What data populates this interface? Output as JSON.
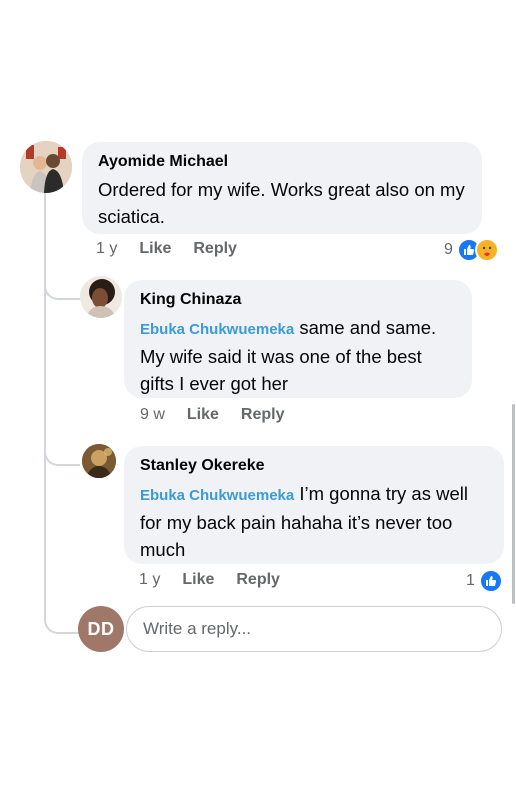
{
  "comments": [
    {
      "author": "Ayomide Michael",
      "text": "Ordered for my wife. Works great also on my sciatica.",
      "time": "1 y",
      "like_label": "Like",
      "reply_label": "Reply",
      "reaction_count": "9",
      "reactions": [
        "like-icon",
        "care-icon"
      ]
    },
    {
      "author": "King Chinaza",
      "mention": "Ebuka Chukwuemeka",
      "text": " same and same. My wife said it was one of the best gifts I ever got her",
      "time": "9 w",
      "like_label": "Like",
      "reply_label": "Reply"
    },
    {
      "author": "Stanley Okereke",
      "mention": "Ebuka Chukwuemeka",
      "text": " I’m gonna try as well for my back pain hahaha it’s never too much",
      "time": "1 y",
      "like_label": "Like",
      "reply_label": "Reply",
      "reaction_count": "1",
      "reactions": [
        "like-icon"
      ]
    }
  ],
  "composer": {
    "initials": "DD",
    "placeholder": "Write a reply..."
  },
  "colors": {
    "like_blue": "#1877f2",
    "mention_blue": "#3a9bd9",
    "bubble_bg": "#f0f2f5",
    "meta_gray": "#65676b"
  }
}
